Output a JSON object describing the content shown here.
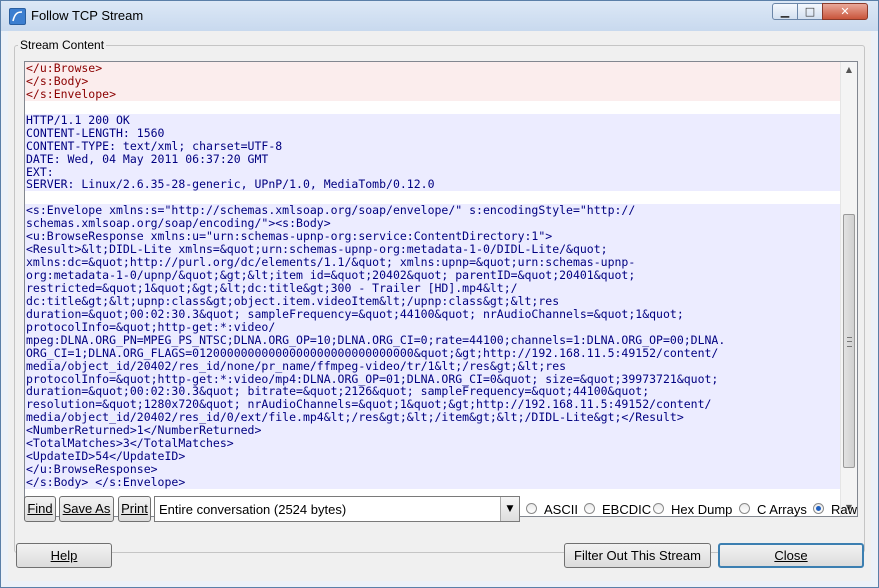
{
  "window": {
    "title": "Follow TCP Stream"
  },
  "group": {
    "label": "Stream Content"
  },
  "stream_lines": [
    {
      "t": "</u:Browse>",
      "k": "req"
    },
    {
      "t": "</s:Body>",
      "k": "req"
    },
    {
      "t": "</s:Envelope>",
      "k": "req"
    },
    {
      "t": "",
      "k": "blank"
    },
    {
      "t": "HTTP/1.1 200 OK",
      "k": "resp"
    },
    {
      "t": "CONTENT-LENGTH: 1560",
      "k": "resp"
    },
    {
      "t": "CONTENT-TYPE: text/xml; charset=UTF-8",
      "k": "resp"
    },
    {
      "t": "DATE: Wed, 04 May 2011 06:37:20 GMT",
      "k": "resp"
    },
    {
      "t": "EXT:",
      "k": "resp"
    },
    {
      "t": "SERVER: Linux/2.6.35-28-generic, UPnP/1.0, MediaTomb/0.12.0",
      "k": "resp"
    },
    {
      "t": "",
      "k": "blank"
    },
    {
      "t": "<s:Envelope xmlns:s=\"http://schemas.xmlsoap.org/soap/envelope/\" s:encodingStyle=\"http://",
      "k": "resp"
    },
    {
      "t": "schemas.xmlsoap.org/soap/encoding/\"><s:Body>",
      "k": "resp"
    },
    {
      "t": "<u:BrowseResponse xmlns:u=\"urn:schemas-upnp-org:service:ContentDirectory:1\">",
      "k": "resp"
    },
    {
      "t": "<Result>&lt;DIDL-Lite xmlns=&quot;urn:schemas-upnp-org:metadata-1-0/DIDL-Lite/&quot;",
      "k": "resp"
    },
    {
      "t": "xmlns:dc=&quot;http://purl.org/dc/elements/1.1/&quot; xmlns:upnp=&quot;urn:schemas-upnp-",
      "k": "resp"
    },
    {
      "t": "org:metadata-1-0/upnp/&quot;&gt;&lt;item id=&quot;20402&quot; parentID=&quot;20401&quot;",
      "k": "resp"
    },
    {
      "t": "restricted=&quot;1&quot;&gt;&lt;dc:title&gt;300 - Trailer [HD].mp4&lt;/",
      "k": "resp"
    },
    {
      "t": "dc:title&gt;&lt;upnp:class&gt;object.item.videoItem&lt;/upnp:class&gt;&lt;res",
      "k": "resp"
    },
    {
      "t": "duration=&quot;00:02:30.3&quot; sampleFrequency=&quot;44100&quot; nrAudioChannels=&quot;1&quot;",
      "k": "resp"
    },
    {
      "t": "protocolInfo=&quot;http-get:*:video/",
      "k": "resp"
    },
    {
      "t": "mpeg:DLNA.ORG_PN=MPEG_PS_NTSC;DLNA.ORG_OP=10;DLNA.ORG_CI=0;rate=44100;channels=1:DLNA.ORG_OP=00;DLNA.",
      "k": "resp"
    },
    {
      "t": "ORG_CI=1;DLNA.ORG_FLAGS=01200000000000000000000000000000&quot;&gt;http://192.168.11.5:49152/content/",
      "k": "resp"
    },
    {
      "t": "media/object_id/20402/res_id/none/pr_name/ffmpeg-video/tr/1&lt;/res&gt;&lt;res",
      "k": "resp"
    },
    {
      "t": "protocolInfo=&quot;http-get:*:video/mp4:DLNA.ORG_OP=01;DLNA.ORG_CI=0&quot; size=&quot;39973721&quot;",
      "k": "resp"
    },
    {
      "t": "duration=&quot;00:02:30.3&quot; bitrate=&quot;2126&quot; sampleFrequency=&quot;44100&quot;",
      "k": "resp"
    },
    {
      "t": "resolution=&quot;1280x720&quot; nrAudioChannels=&quot;1&quot;&gt;http://192.168.11.5:49152/content/",
      "k": "resp"
    },
    {
      "t": "media/object_id/20402/res_id/0/ext/file.mp4&lt;/res&gt;&lt;/item&gt;&lt;/DIDL-Lite&gt;</Result>",
      "k": "resp"
    },
    {
      "t": "<NumberReturned>1</NumberReturned>",
      "k": "resp"
    },
    {
      "t": "<TotalMatches>3</TotalMatches>",
      "k": "resp"
    },
    {
      "t": "<UpdateID>54</UpdateID>",
      "k": "resp"
    },
    {
      "t": "</u:BrowseResponse>",
      "k": "resp"
    },
    {
      "t": "</s:Body> </s:Envelope>",
      "k": "resp"
    }
  ],
  "toolbar": {
    "find_label": "Find",
    "save_as_label": "Save As",
    "print_label": "Print",
    "conversation_selected": "Entire conversation (2524 bytes)"
  },
  "format_options": [
    {
      "label": "ASCII",
      "selected": false
    },
    {
      "label": "EBCDIC",
      "selected": false
    },
    {
      "label": "Hex Dump",
      "selected": false
    },
    {
      "label": "C Arrays",
      "selected": false
    },
    {
      "label": "Raw",
      "selected": true
    }
  ],
  "bottom": {
    "help_label": "Help",
    "filter_label": "Filter Out This Stream",
    "close_label": "Close"
  },
  "colors": {
    "request_text": "#8b0000",
    "request_bg": "#fbeded",
    "response_text": "#000080",
    "response_bg": "#ececff"
  },
  "icons": [
    "app-icon",
    "minimize-icon",
    "maximize-icon",
    "close-icon",
    "scroll-up-icon",
    "scroll-down-icon",
    "dropdown-arrow-icon"
  ]
}
